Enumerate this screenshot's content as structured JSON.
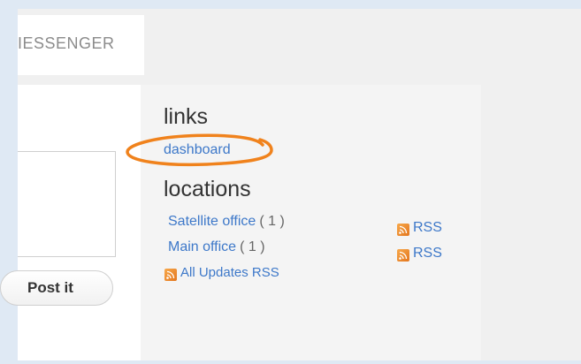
{
  "header": {
    "title": "IESSENGER"
  },
  "compose": {
    "post_button_label": "Post it"
  },
  "sidebar": {
    "links_heading": "links",
    "dashboard_label": "dashboard",
    "locations_heading": "locations",
    "locations": [
      {
        "name": "Satellite office",
        "count": "( 1 )",
        "rss_label": "RSS"
      },
      {
        "name": "Main office",
        "count": "( 1 )",
        "rss_label": "RSS"
      }
    ],
    "all_updates_label": "All Updates RSS"
  },
  "colors": {
    "link": "#3d78c9",
    "highlight_ring": "#f0821c",
    "rss_icon": "#e8832a"
  },
  "icons": {
    "rss": "rss-feed-icon"
  }
}
